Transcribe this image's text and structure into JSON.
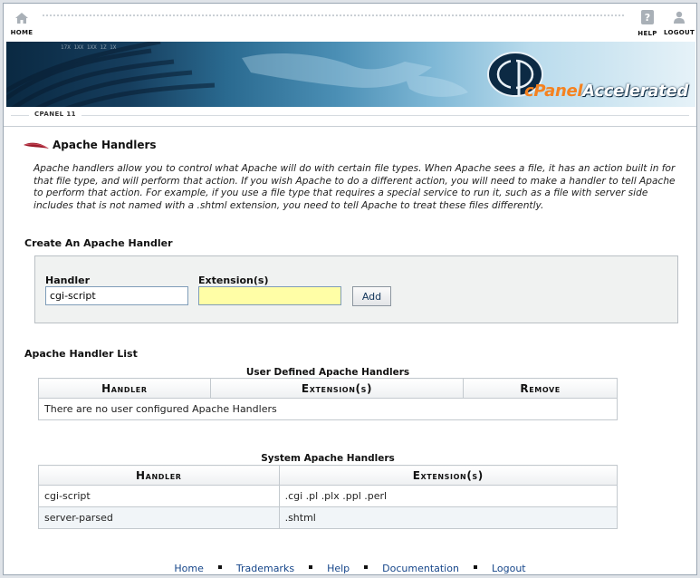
{
  "topnav": {
    "home_label": "HOME",
    "help_label": "HELP",
    "logout_label": "LOGOUT",
    "icon_color": "#a9b0b7"
  },
  "banner": {
    "brand_part1": "cPanel",
    "brand_part2": "Accelerated",
    "accent": "#f58220"
  },
  "breadcrumb": "CPANEL 11",
  "page": {
    "title": "Apache Handlers",
    "intro": "Apache handlers allow you to control what Apache will do with certain file types. When Apache sees a file, it has an action built in for that file type, and will perform that action. If you wish Apache to do a different action, you will need to make a handler to tell Apache to perform that action. For example, if you use a file type that requires a special service to run it, such as a file with server side includes that is not named with a .shtml extension, you need to tell Apache to treat these files differently."
  },
  "create": {
    "title": "Create An Apache Handler",
    "handler_label": "Handler",
    "handler_value": "cgi-script",
    "extension_label": "Extension(s)",
    "extension_value": "",
    "add_label": "Add"
  },
  "list": {
    "title": "Apache Handler List",
    "user": {
      "caption": "User Defined Apache Handlers",
      "headers": [
        "Handler",
        "Extension(s)",
        "Remove"
      ],
      "empty_message": "There are no user configured Apache Handlers"
    },
    "system": {
      "caption": "System Apache Handlers",
      "headers": [
        "Handler",
        "Extension(s)"
      ],
      "rows": [
        [
          "cgi-script",
          ".cgi .pl .plx .ppl .perl"
        ],
        [
          "server-parsed",
          ".shtml"
        ]
      ]
    }
  },
  "footer": {
    "links": [
      "Home",
      "Trademarks",
      "Help",
      "Documentation",
      "Logout"
    ]
  }
}
